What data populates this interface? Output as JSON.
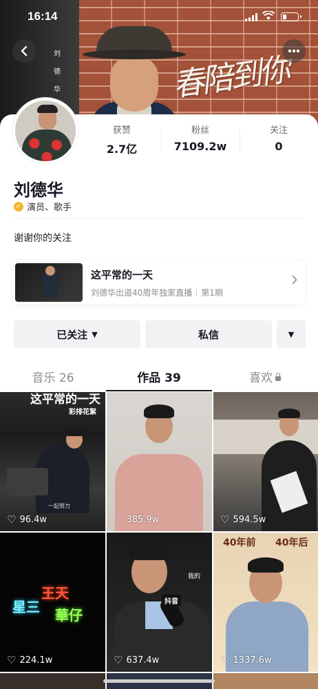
{
  "status_bar": {
    "time": "16:14",
    "battery_percent": 25
  },
  "banner": {
    "calligraphy": "春陪到你",
    "vertical_text": "刘德华",
    "back_icon": "chevron-left-icon",
    "more_icon": "more-dots-icon"
  },
  "profile": {
    "stats": [
      {
        "label": "获赞",
        "value": "2.7亿"
      },
      {
        "label": "粉丝",
        "value": "7109.2w"
      },
      {
        "label": "关注",
        "value": "0"
      }
    ],
    "name": "刘德华",
    "verify_badge_icon": "verified-check-icon",
    "verification": "演员、歌手",
    "bio": "谢谢你的关注"
  },
  "live_card": {
    "title": "这平常的一天",
    "subtitle": "刘德华出道40周年独家直播",
    "episode": "第1期",
    "arrow_icon": "chevron-right-icon"
  },
  "actions": {
    "follow_label": "已关注",
    "message_label": "私信",
    "dropdown_icon": "triangle-down-icon"
  },
  "tabs": [
    {
      "label": "音乐 26",
      "active": false
    },
    {
      "label": "作品 39",
      "active": true
    },
    {
      "label": "喜欢",
      "active": false,
      "locked": true
    }
  ],
  "videos": [
    {
      "likes": "96.4w",
      "overlay_top": "这平常的一天",
      "overlay_tag": "彩排花絮",
      "overlay_small": "一起努力"
    },
    {
      "likes": "385.9w"
    },
    {
      "likes": "594.5w"
    },
    {
      "likes": "224.1w",
      "overlay_neon_1": "星三",
      "overlay_neon_2": "王天",
      "overlay_neon_3": "華仔"
    },
    {
      "likes": "637.4w",
      "overlay_tag": "抖音",
      "overlay_small": "我的"
    },
    {
      "likes": "1337.6w",
      "overlay_left": "40年前",
      "overlay_right": "40年后"
    }
  ],
  "colors": {
    "accent_verify": "#f3b62a",
    "text_primary": "#161823",
    "text_secondary": "#8a8b91"
  }
}
